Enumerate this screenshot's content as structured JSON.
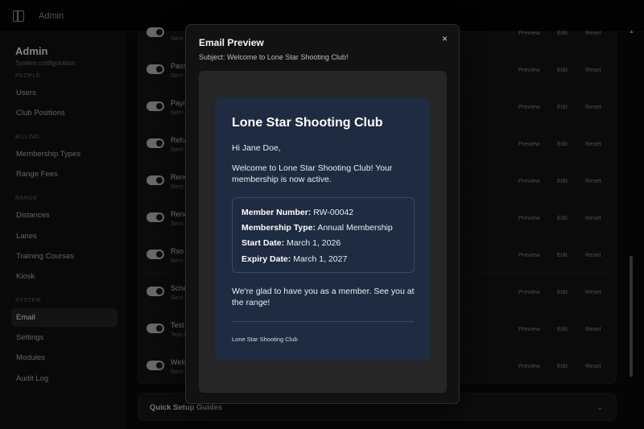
{
  "topbar": {
    "breadcrumb": "Admin",
    "toggle_icon": "sidebar-toggle-icon"
  },
  "sidebar": {
    "title": "Admin",
    "subtitle": "System configuration",
    "sections": [
      {
        "label": "PEOPLE",
        "items": [
          "Users",
          "Club Positions"
        ]
      },
      {
        "label": "BILLING",
        "items": [
          "Membership Types",
          "Range Fees"
        ]
      },
      {
        "label": "RANGE",
        "items": [
          "Distances",
          "Lanes",
          "Training Courses",
          "Kiosk"
        ]
      },
      {
        "label": "SYSTEM",
        "items": [
          "Email",
          "Settings",
          "Modules",
          "Audit Log"
        ]
      }
    ],
    "active_item": "Email"
  },
  "templates": {
    "actions": {
      "preview": "Preview",
      "edit": "Edit",
      "reset": "Reset"
    },
    "rows": [
      {
        "name": "",
        "status": "Sent",
        "enabled": true
      },
      {
        "name": "Pass",
        "status": "Sent",
        "enabled": true
      },
      {
        "name": "Payn",
        "status": "Sent",
        "enabled": true
      },
      {
        "name": "Refu",
        "status": "Sent",
        "enabled": true
      },
      {
        "name": "Rene",
        "status": "Sent",
        "enabled": true
      },
      {
        "name": "Rene",
        "status": "Sent",
        "enabled": true
      },
      {
        "name": "Rso",
        "status": "Sent",
        "enabled": true
      },
      {
        "name": "Sche",
        "status": "Sent",
        "enabled": true
      },
      {
        "name": "Test",
        "status": "Test e",
        "enabled": true
      },
      {
        "name": "Welc",
        "status": "Sent",
        "enabled": true
      }
    ]
  },
  "guides": {
    "label": "Quick Setup Guides",
    "chevron_icon": "chevron-down-icon"
  },
  "modal": {
    "title": "Email Preview",
    "subject": "Subject: Welcome to Lone Star Shooting Club!",
    "close_label": "×",
    "email": {
      "heading": "Lone Star Shooting Club",
      "greeting": "Hi Jane Doe,",
      "body": "Welcome to Lone Star Shooting Club! Your membership is now active.",
      "details": [
        {
          "label": "Member Number:",
          "value": "RW-00042"
        },
        {
          "label": "Membership Type:",
          "value": "Annual Membership"
        },
        {
          "label": "Start Date:",
          "value": "March 1, 2026"
        },
        {
          "label": "Expiry Date:",
          "value": "March 1, 2027"
        }
      ],
      "closing": "We're glad to have you as a member. See you at the range!",
      "footer": "Lone Star Shooting Club"
    }
  },
  "colors": {
    "email_card_bg": "#1e2b40",
    "active_nav_bg": "#262626"
  }
}
